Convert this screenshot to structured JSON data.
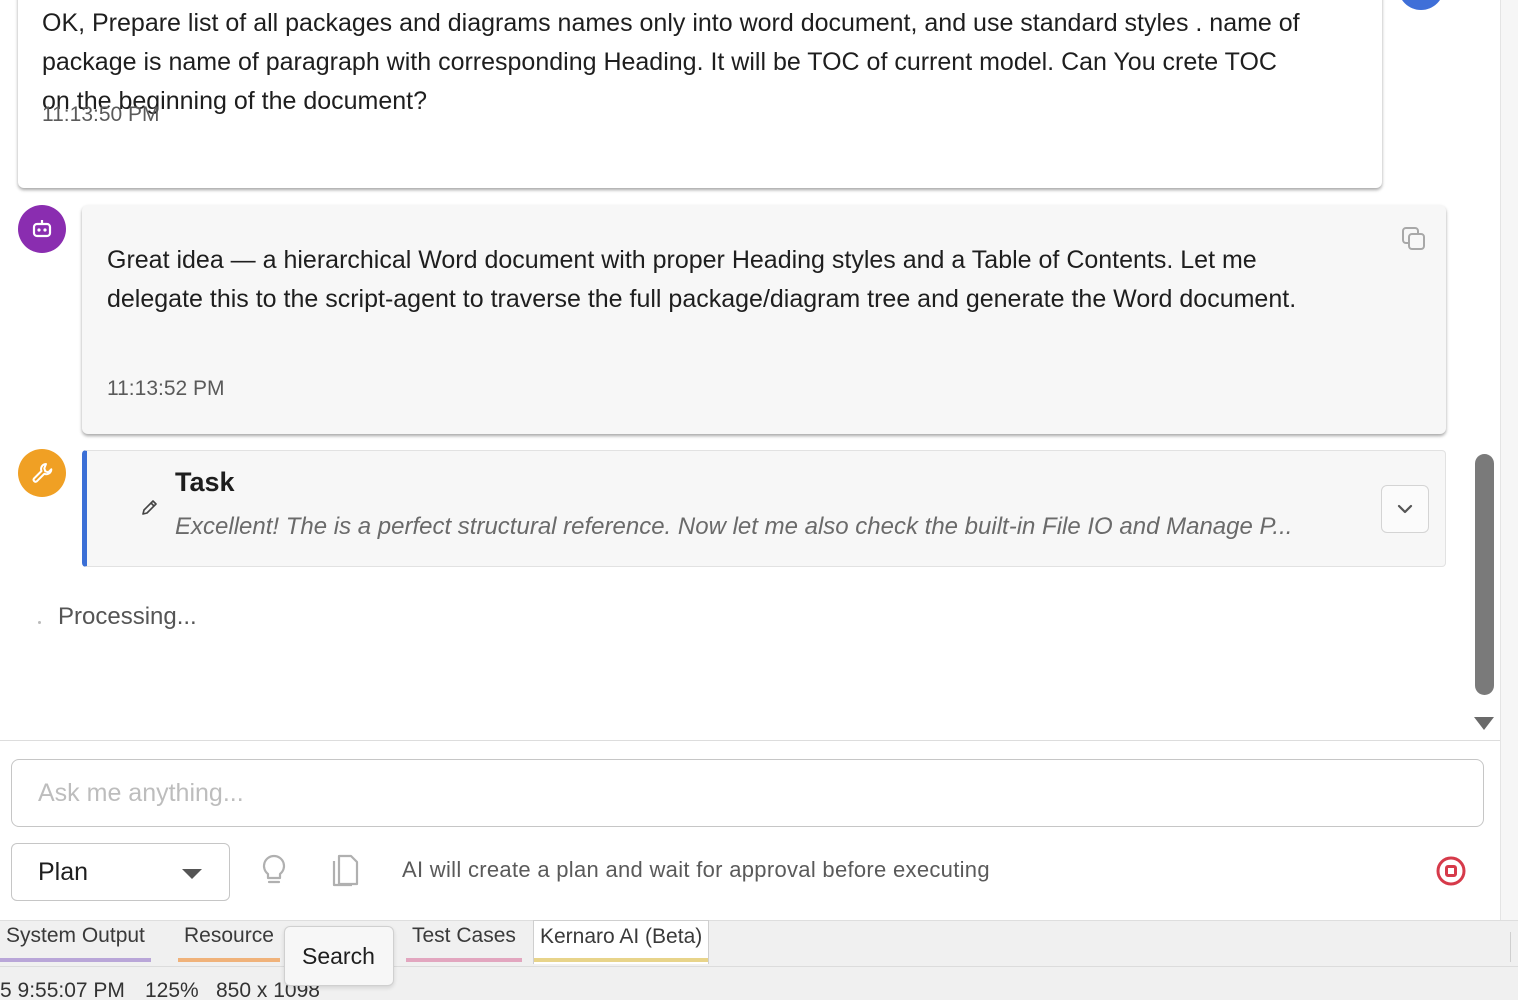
{
  "messages": {
    "user": {
      "text": "OK, Prepare list of all packages and diagrams names only into word document, and use standard styles . name of package is name of paragraph with corresponding Heading. It will be TOC of current model. Can You crete TOC on the beginning of the document?",
      "time": "11:13:50 PM"
    },
    "assistant": {
      "text": "Great idea — a hierarchical Word document with proper Heading styles and a Table of Contents. Let me delegate this to the script-agent to traverse the full package/diagram tree and generate the Word document.",
      "time": "11:13:52 PM"
    },
    "task": {
      "title": "Task",
      "description": "Excellent! The is a perfect structural reference. Now let me also check the built-in File IO and Manage P..."
    }
  },
  "status": {
    "processing": "Processing..."
  },
  "composer": {
    "placeholder": "Ask me anything...",
    "mode_value": "Plan",
    "mode_hint": "AI will create a plan and wait for approval before executing"
  },
  "tabs": [
    {
      "label": "System Output",
      "color": "#b9a6d8"
    },
    {
      "label": "Resource",
      "color": "#f0b27a"
    },
    {
      "label": "Test Cases",
      "color": "#e2a6bf"
    },
    {
      "label": "Kernaro AI (Beta)",
      "color": "#e8d48a",
      "active": true
    }
  ],
  "tooltip": "Search",
  "statusbar": {
    "time": "5 9:55:07 PM",
    "zoom": "125%",
    "size": "850 x 1098"
  },
  "colors": {
    "bot_avatar": "#8a2db0",
    "tool_avatar": "#f0a024",
    "task_accent": "#3b6fd6",
    "stop": "#d63a4a"
  },
  "icons": {
    "bot": "robot-icon",
    "tool": "wrench-icon",
    "copy": "copy-icon",
    "expand": "chevron-down-icon",
    "idea": "lightbulb-icon",
    "attach": "clipboard-icon",
    "stop": "stop-icon"
  }
}
